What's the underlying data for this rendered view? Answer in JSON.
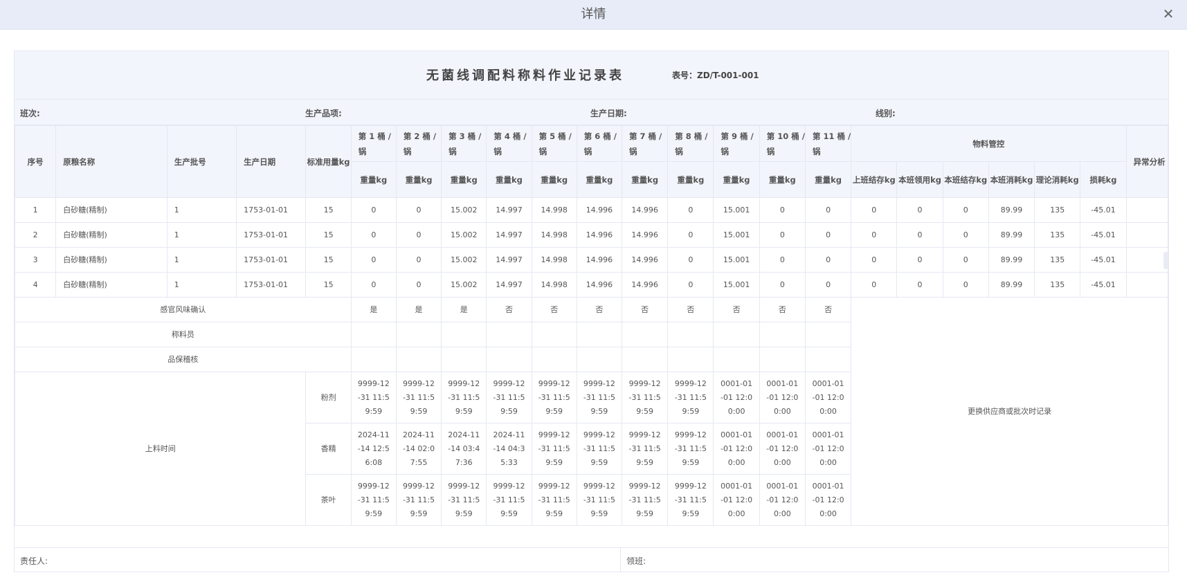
{
  "window": {
    "title": "详情",
    "close_icon": "close-icon"
  },
  "form": {
    "title": "无菌线调配料称料作业记录表",
    "code": "表号：ZD/T-001-001"
  },
  "info": {
    "shift": "班次:",
    "product": "生产品项:",
    "prod_date": "生产日期:",
    "line": "线别:"
  },
  "headers": {
    "seq": "序号",
    "material": "原粮名称",
    "batch": "生产批号",
    "date": "生产日期",
    "std": "标准用量kg",
    "buckets": [
      "第 1 桶 / 锅",
      "第 2 桶 / 锅",
      "第 3 桶 / 锅",
      "第 4 桶 / 锅",
      "第 5 桶 / 锅",
      "第 6 桶 / 锅",
      "第 7 桶 / 锅",
      "第 8 桶 / 锅",
      "第 9 桶 / 锅",
      "第 10 桶 / 锅",
      "第 11 桶 / 锅"
    ],
    "weight": "重量kg",
    "control": "物料管控",
    "control_cols": [
      "上班结存kg",
      "本班领用kg",
      "本班结存kg",
      "本班消耗kg",
      "理论消耗kg",
      "损耗kg"
    ],
    "abnormal": "异常分析"
  },
  "rows": [
    {
      "seq": "1",
      "material": "白砂糖(精制)",
      "batch": "1",
      "date": "1753-01-01",
      "std": "15",
      "weights": [
        "0",
        "0",
        "15.002",
        "14.997",
        "14.998",
        "14.996",
        "14.996",
        "0",
        "15.001",
        "0",
        "0"
      ],
      "control": [
        "0",
        "0",
        "0",
        "89.99",
        "135",
        "-45.01"
      ],
      "abnormal": ""
    },
    {
      "seq": "2",
      "material": "白砂糖(精制)",
      "batch": "1",
      "date": "1753-01-01",
      "std": "15",
      "weights": [
        "0",
        "0",
        "15.002",
        "14.997",
        "14.998",
        "14.996",
        "14.996",
        "0",
        "15.001",
        "0",
        "0"
      ],
      "control": [
        "0",
        "0",
        "0",
        "89.99",
        "135",
        "-45.01"
      ],
      "abnormal": ""
    },
    {
      "seq": "3",
      "material": "白砂糖(精制)",
      "batch": "1",
      "date": "1753-01-01",
      "std": "15",
      "weights": [
        "0",
        "0",
        "15.002",
        "14.997",
        "14.998",
        "14.996",
        "14.996",
        "0",
        "15.001",
        "0",
        "0"
      ],
      "control": [
        "0",
        "0",
        "0",
        "89.99",
        "135",
        "-45.01"
      ],
      "abnormal": ""
    },
    {
      "seq": "4",
      "material": "白砂糖(精制)",
      "batch": "1",
      "date": "1753-01-01",
      "std": "15",
      "weights": [
        "0",
        "0",
        "15.002",
        "14.997",
        "14.998",
        "14.996",
        "14.996",
        "0",
        "15.001",
        "0",
        "0"
      ],
      "control": [
        "0",
        "0",
        "0",
        "89.99",
        "135",
        "-45.01"
      ],
      "abnormal": ""
    }
  ],
  "sensory": {
    "label": "感官风味确认",
    "values": [
      "是",
      "是",
      "是",
      "否",
      "否",
      "否",
      "否",
      "否",
      "否",
      "否",
      "否"
    ]
  },
  "weigher": {
    "label": "称料员"
  },
  "qa": {
    "label": "品保稽核"
  },
  "feed_time": {
    "label": "上料时间",
    "supplier_note": "更换供应商或批次时记录",
    "rows": [
      {
        "name": "粉剂",
        "values": [
          "9999-12-31 11:59:59",
          "9999-12-31 11:59:59",
          "9999-12-31 11:59:59",
          "9999-12-31 11:59:59",
          "9999-12-31 11:59:59",
          "9999-12-31 11:59:59",
          "9999-12-31 11:59:59",
          "9999-12-31 11:59:59",
          "0001-01-01 12:00:00",
          "0001-01-01 12:00:00",
          "0001-01-01 12:00:00"
        ]
      },
      {
        "name": "香精",
        "values": [
          "2024-11-14 12:56:08",
          "2024-11-14 02:07:55",
          "2024-11-14 03:47:36",
          "2024-11-14 04:35:33",
          "9999-12-31 11:59:59",
          "9999-12-31 11:59:59",
          "9999-12-31 11:59:59",
          "9999-12-31 11:59:59",
          "0001-01-01 12:00:00",
          "0001-01-01 12:00:00",
          "0001-01-01 12:00:00"
        ]
      },
      {
        "name": "茶叶",
        "values": [
          "9999-12-31 11:59:59",
          "9999-12-31 11:59:59",
          "9999-12-31 11:59:59",
          "9999-12-31 11:59:59",
          "9999-12-31 11:59:59",
          "9999-12-31 11:59:59",
          "9999-12-31 11:59:59",
          "9999-12-31 11:59:59",
          "0001-01-01 12:00:00",
          "0001-01-01 12:00:00",
          "0001-01-01 12:00:00"
        ]
      }
    ]
  },
  "footer": {
    "responsible": "责任人:",
    "leader": "领班:"
  }
}
